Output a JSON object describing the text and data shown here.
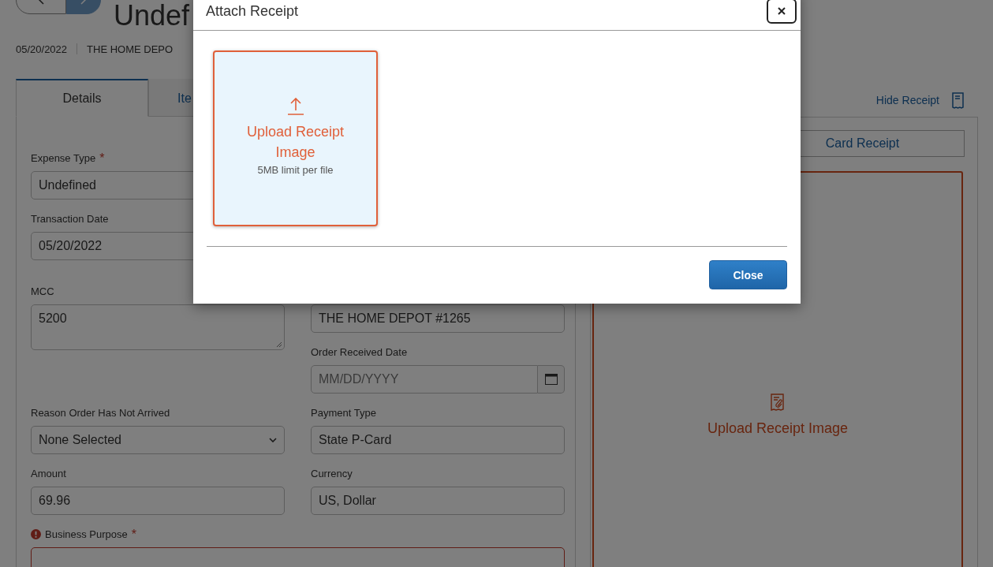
{
  "header": {
    "title": "Undef",
    "date": "05/20/2022",
    "merchant": "THE HOME DEPO"
  },
  "tabs": [
    {
      "label": "Details",
      "selected": true
    },
    {
      "label": "Ite",
      "selected": false
    }
  ],
  "form": {
    "rows": [
      {
        "left": {
          "kind": "text",
          "label": "Expense Type",
          "required_mark": "*",
          "value": "Undefined"
        }
      },
      {
        "left": {
          "kind": "text",
          "label": "Transaction Date",
          "value": "05/20/2022"
        }
      },
      {
        "left": {
          "kind": "textarea",
          "label": "MCC",
          "value": "5200",
          "error": false
        },
        "right": {
          "kind": "text",
          "value": "THE HOME DEPOT #1265"
        }
      },
      {
        "right": {
          "kind": "date",
          "label": "Order Received Date",
          "placeholder": "MM/DD/YYYY"
        }
      },
      {
        "left": {
          "kind": "select",
          "label": "Reason Order Has Not Arrived",
          "value": "None Selected"
        },
        "right": {
          "kind": "text",
          "label": "Payment Type",
          "value": "State P-Card"
        }
      },
      {
        "left": {
          "kind": "text",
          "label": "Amount",
          "value": "69.96"
        },
        "right": {
          "kind": "text",
          "label": "Currency",
          "value": "US, Dollar"
        }
      },
      {
        "full": {
          "kind": "textarea",
          "label": "Business Purpose",
          "required_mark": "*",
          "error": true
        }
      }
    ]
  },
  "receipt_panel": {
    "hide_link": "Hide Receipt",
    "card_receipt_button": "Card Receipt",
    "upload_label": "Upload Receipt Image"
  },
  "dialog": {
    "title": "Attach Receipt",
    "upload_tile": {
      "label": "Upload Receipt Image",
      "hint": "5MB limit per file"
    },
    "close_button": "Close"
  }
}
